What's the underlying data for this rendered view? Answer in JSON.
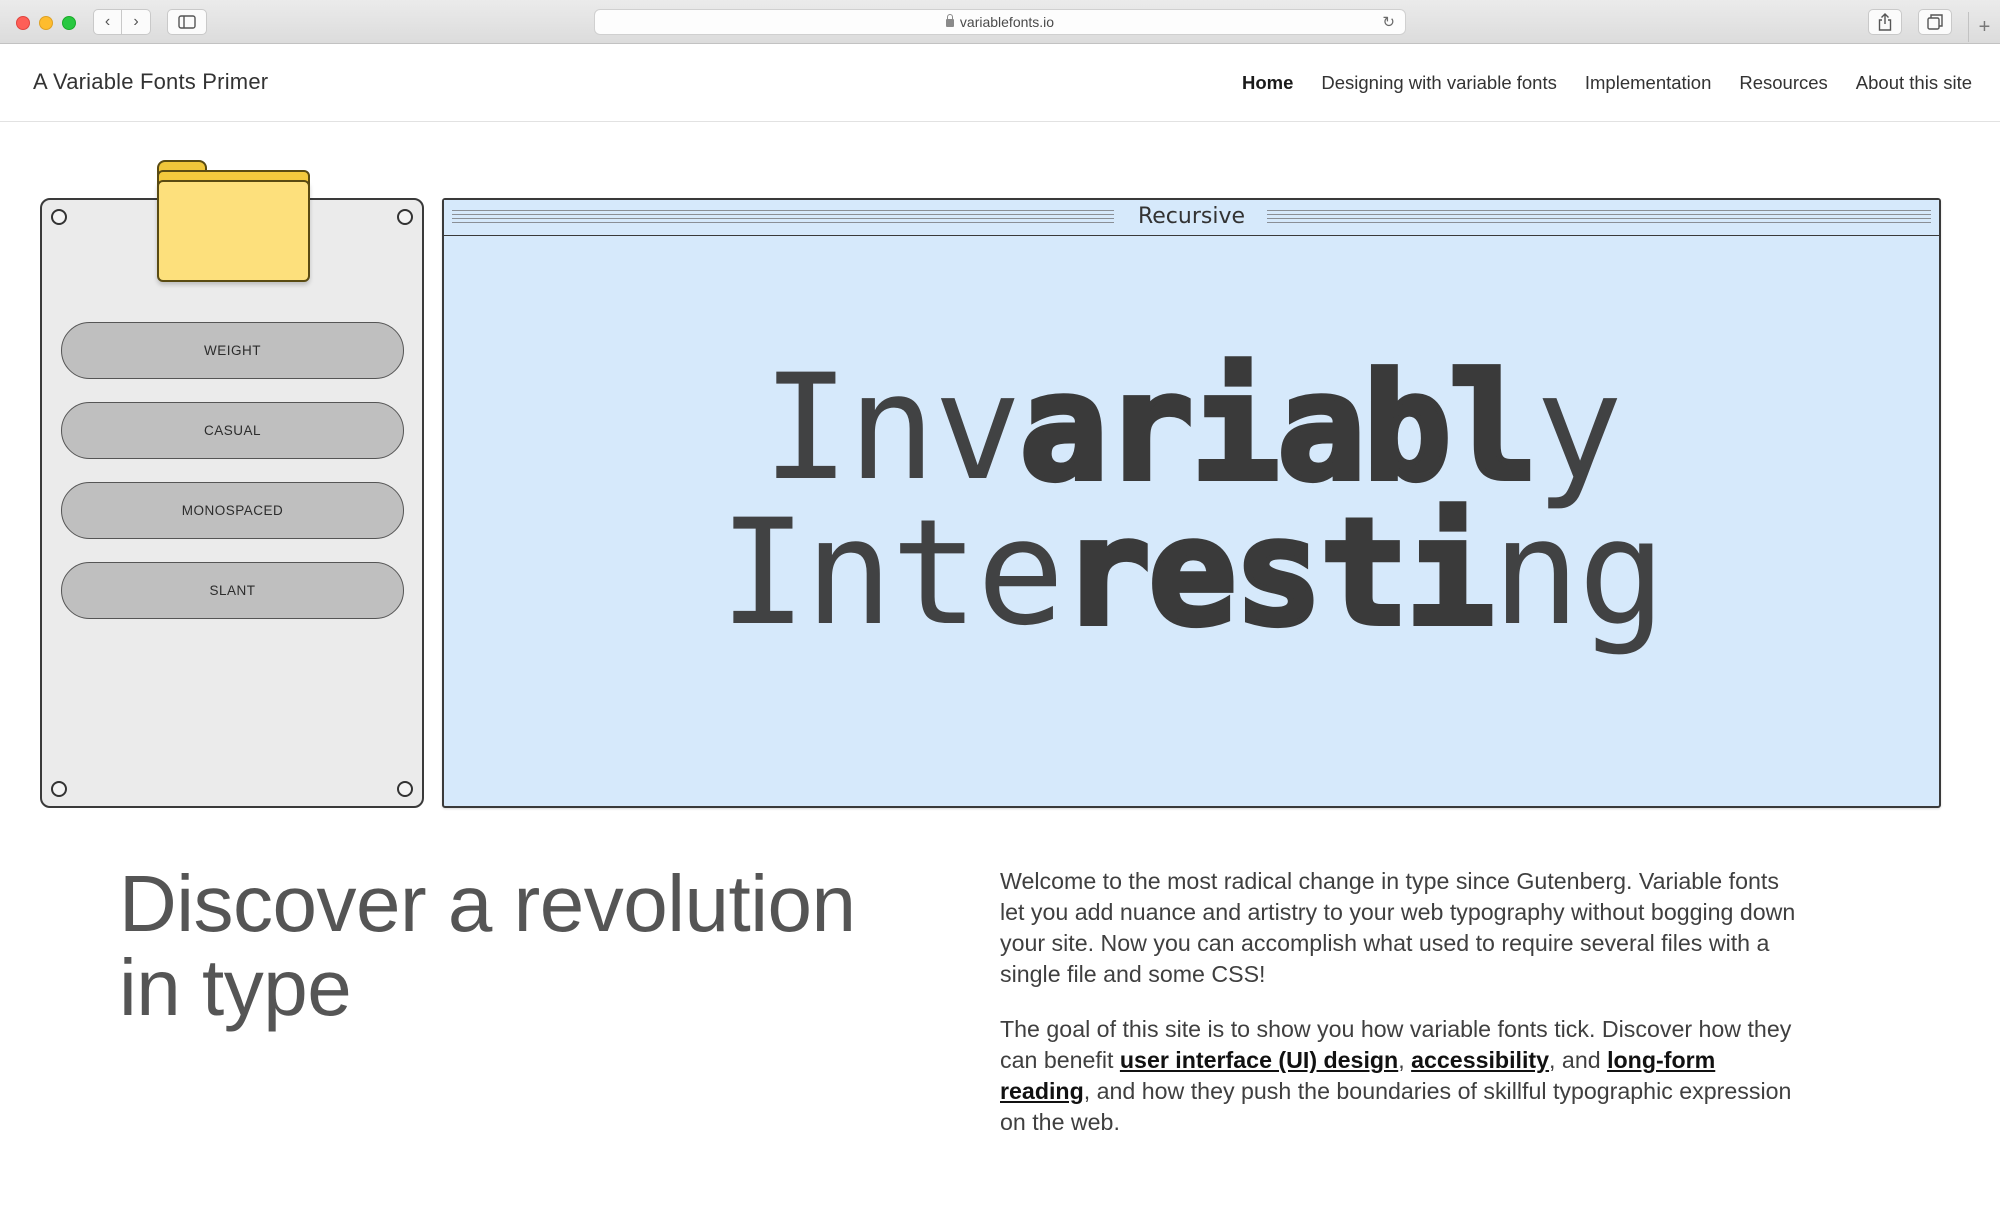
{
  "browser": {
    "url": "variablefonts.io",
    "icons": [
      "back-chevron-icon",
      "forward-chevron-icon",
      "sidebar-icon",
      "lock-icon",
      "reload-icon",
      "share-icon",
      "tabs-icon",
      "plus-icon"
    ]
  },
  "header": {
    "site_title": "A Variable Fonts Primer",
    "nav": [
      "Home",
      "Designing with variable fonts",
      "Implementation",
      "Resources",
      "About this site"
    ],
    "active_nav": "Home"
  },
  "controls": {
    "buttons": [
      "WEIGHT",
      "CASUAL",
      "MONOSPACED",
      "SLANT"
    ],
    "folder_icon": "folder-icon"
  },
  "specimen": {
    "font_name": "Recursive",
    "line1_thin": "Inv",
    "line1_heavy": "ariabl",
    "line1_end": "y",
    "line2_thin": "Inte",
    "line2_heavy": "resti",
    "line2_end": "ng",
    "background": "#d6e9fb"
  },
  "main": {
    "heading": "Discover a revolution in type",
    "p1": "Welcome to the most radical change in type since Gutenberg. Variable fonts let you add nuance and artistry to your web typography without bogging down your site. Now you can accomplish what used to require several files with a single file and some CSS!",
    "p2_a": "The goal of this site is to show you how variable fonts tick. Discover how they can benefit ",
    "link_ui": "user interface (UI) design",
    "p2_b": ", ",
    "link_a11y": "accessibility",
    "p2_c": ", and ",
    "link_reading": "long-form reading",
    "p2_d": ", and how they push the boundaries of skillful typographic expression on the web."
  }
}
